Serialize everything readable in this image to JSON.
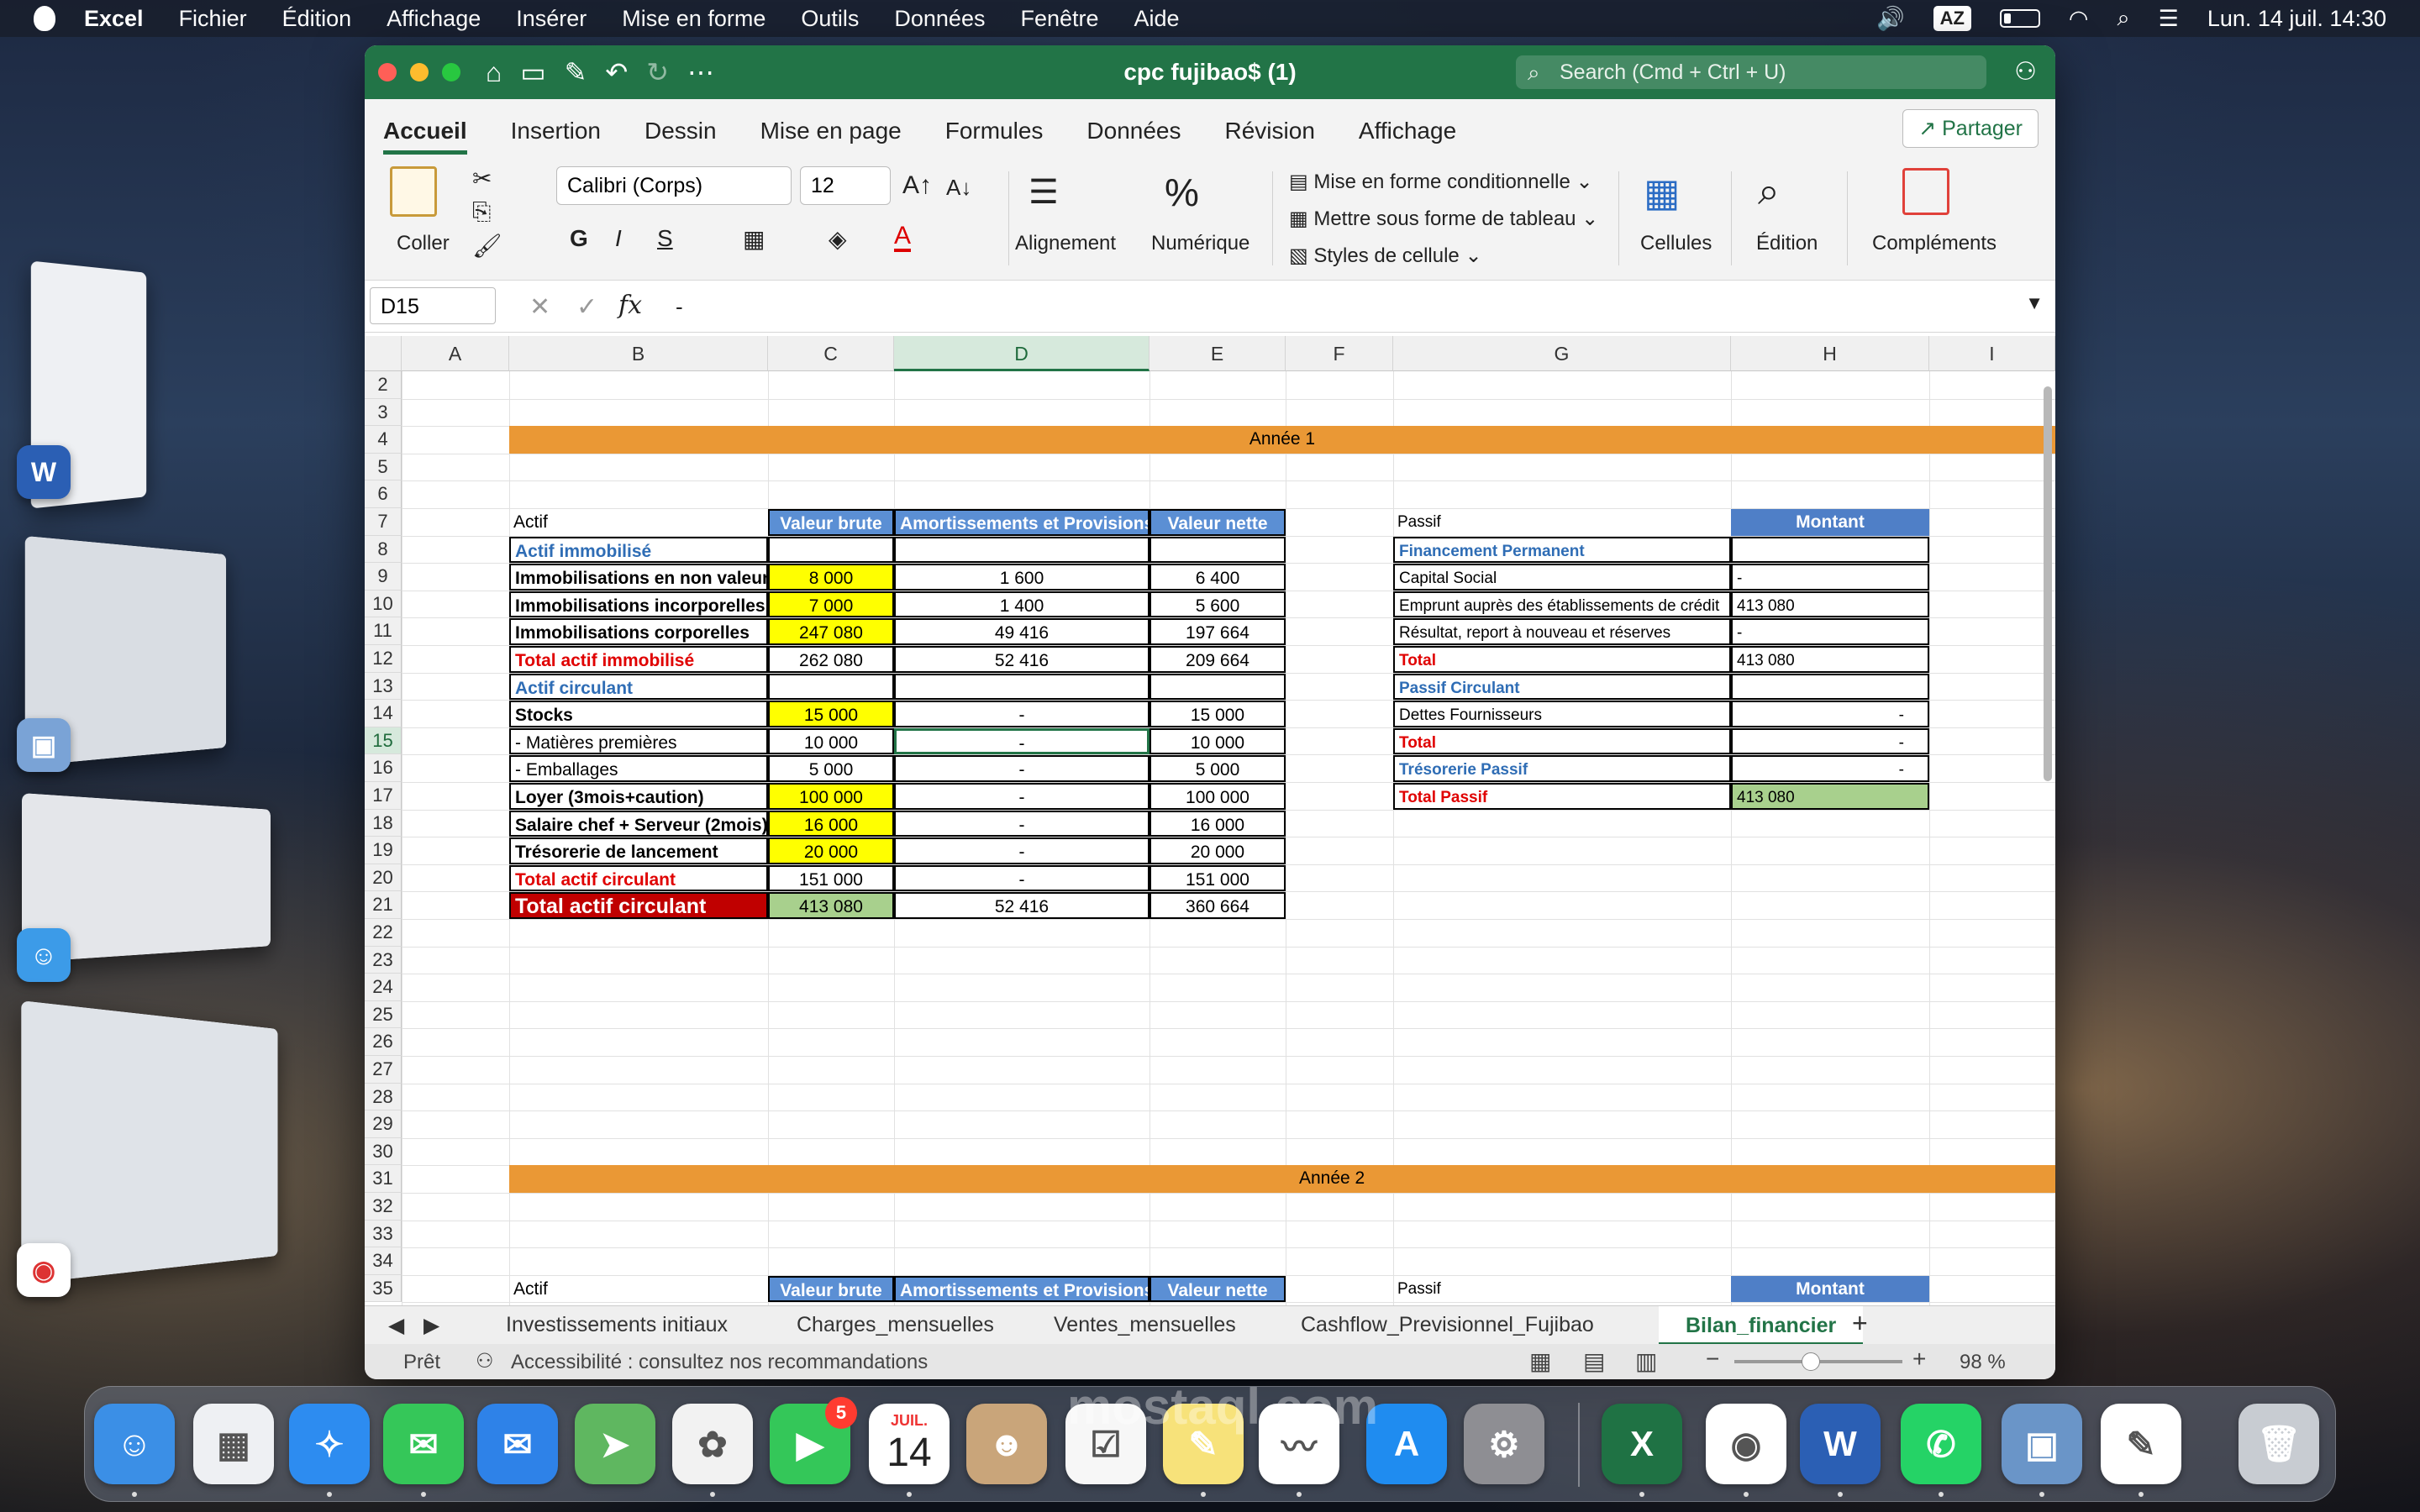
{
  "menubar": {
    "app": "Excel",
    "items": [
      "Fichier",
      "Édition",
      "Affichage",
      "Insérer",
      "Mise en forme",
      "Outils",
      "Données",
      "Fenêtre",
      "Aide"
    ],
    "input_source": "AZ",
    "datetime": "Lun. 14 juil.  14:30"
  },
  "window": {
    "title": "cpc fujibao$ (1)",
    "search_placeholder": "Search (Cmd + Ctrl + U)"
  },
  "ribbon": {
    "tabs": [
      "Accueil",
      "Insertion",
      "Dessin",
      "Mise en page",
      "Formules",
      "Données",
      "Révision",
      "Affichage"
    ],
    "share": "Partager",
    "paste": "Coller",
    "font": "Calibri (Corps)",
    "size": "12",
    "bold": "G",
    "italic": "I",
    "underline": "S",
    "alignment": "Alignement",
    "number": "Numérique",
    "cond_format": "Mise en forme conditionnelle",
    "table_format": "Mettre sous forme de tableau",
    "cell_styles": "Styles de cellule",
    "cells": "Cellules",
    "editing": "Édition",
    "addins": "Compléments"
  },
  "formula_bar": {
    "cell_ref": "D15",
    "fx": "fx",
    "value": "-"
  },
  "columns": [
    "A",
    "B",
    "C",
    "D",
    "E",
    "F",
    "G",
    "H",
    "I"
  ],
  "rows": [
    "2",
    "3",
    "4",
    "5",
    "6",
    "7",
    "8",
    "9",
    "10",
    "11",
    "12",
    "13",
    "14",
    "15",
    "16",
    "17",
    "18",
    "19",
    "20",
    "21",
    "22",
    "23",
    "24",
    "25",
    "26",
    "27",
    "28",
    "29",
    "30",
    "31",
    "32",
    "33",
    "34",
    "35"
  ],
  "sheet": {
    "year1": "Année 1",
    "year2": "Année 2",
    "actif_header": [
      "Actif",
      "Valeur brute",
      "Amortissements et Provisions",
      "Valeur nette"
    ],
    "actif_rows": [
      [
        "Actif immobilisé",
        "",
        "",
        ""
      ],
      [
        "Immobilisations en non valeurs",
        "8 000",
        "1 600",
        "6 400"
      ],
      [
        "Immobilisations incorporelles",
        "7 000",
        "1 400",
        "5 600"
      ],
      [
        "Immobilisations corporelles",
        "247 080",
        "49 416",
        "197 664"
      ],
      [
        "Total actif immobilisé",
        "262 080",
        "52 416",
        "209 664"
      ],
      [
        "Actif circulant",
        "",
        "",
        ""
      ],
      [
        "Stocks",
        "15 000",
        "-",
        "15 000"
      ],
      [
        "- Matières premières",
        "10 000",
        "-",
        "10 000"
      ],
      [
        "- Emballages",
        "5 000",
        "-",
        "5 000"
      ],
      [
        "Loyer (3mois+caution)",
        "100 000",
        "-",
        "100 000"
      ],
      [
        "Salaire chef + Serveur (2mois)",
        "16 000",
        "-",
        "16 000"
      ],
      [
        "Trésorerie de lancement",
        "20 000",
        "-",
        "20 000"
      ],
      [
        "Total actif circulant",
        "151 000",
        "-",
        "151 000"
      ],
      [
        "Total actif circulant",
        "413 080",
        "52 416",
        "360 664"
      ]
    ],
    "passif_header": [
      "Passif",
      "Montant"
    ],
    "passif_rows": [
      [
        "Financement Permanent",
        ""
      ],
      [
        "Capital Social",
        "-"
      ],
      [
        "Emprunt auprès des établissements de crédit",
        "413 080"
      ],
      [
        "Résultat, report à nouveau et réserves",
        "-"
      ],
      [
        "Total",
        "413 080"
      ],
      [
        "Passif Circulant",
        ""
      ],
      [
        "Dettes Fournisseurs",
        "-"
      ],
      [
        "Total",
        "-"
      ],
      [
        "Trésorerie Passif",
        "-"
      ],
      [
        "Total Passif",
        "413 080"
      ]
    ],
    "actif_header2": [
      "Actif",
      "Valeur brute",
      "Amortissements et Provisions",
      "Valeur nette"
    ],
    "passif_header2": [
      "Passif",
      "Montant"
    ]
  },
  "sheet_tabs": [
    "Investissements initiaux",
    "Charges_mensuelles",
    "Ventes_mensuelles",
    "Cashflow_Previsionnel_Fujibao",
    "Bilan_financier"
  ],
  "status": {
    "ready": "Prêt",
    "accessibility": "Accessibilité : consultez nos recommandations",
    "zoom": "98 %"
  },
  "dock": {
    "calendar_month": "JUIL.",
    "calendar_day": "14",
    "facetime_badge": "5"
  },
  "watermark": "mostaql.com"
}
